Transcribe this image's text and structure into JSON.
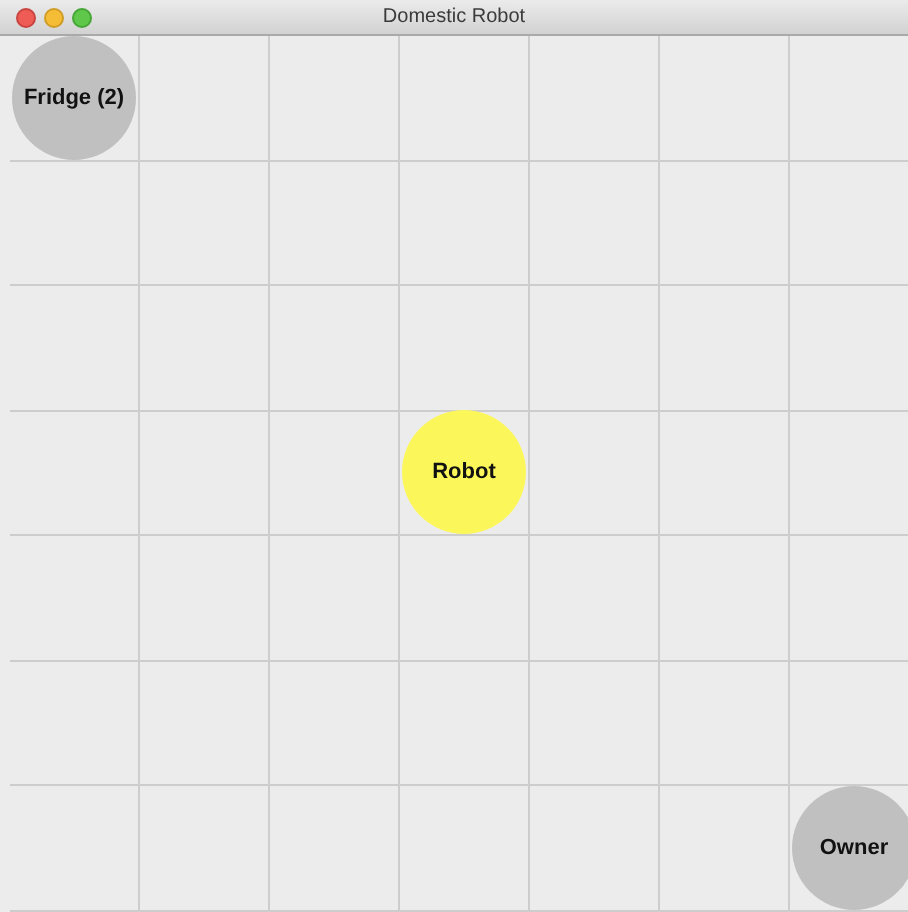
{
  "window": {
    "title": "Domestic Robot"
  },
  "grid": {
    "rows": [
      [
        {
          "agent": {
            "label": "Fridge (2)",
            "color": "#c0c0c0"
          }
        },
        {},
        {},
        {},
        {},
        {},
        {}
      ],
      [
        {},
        {},
        {},
        {},
        {},
        {},
        {}
      ],
      [
        {},
        {},
        {},
        {},
        {},
        {},
        {}
      ],
      [
        {},
        {},
        {},
        {
          "agent": {
            "label": "Robot",
            "color": "#fbf75a"
          }
        },
        {},
        {},
        {}
      ],
      [
        {},
        {},
        {},
        {},
        {},
        {},
        {}
      ],
      [
        {},
        {},
        {},
        {},
        {},
        {},
        {}
      ],
      [
        {},
        {},
        {},
        {},
        {},
        {},
        {
          "agent": {
            "label": "Owner",
            "color": "#c0c0c0"
          }
        }
      ]
    ]
  }
}
